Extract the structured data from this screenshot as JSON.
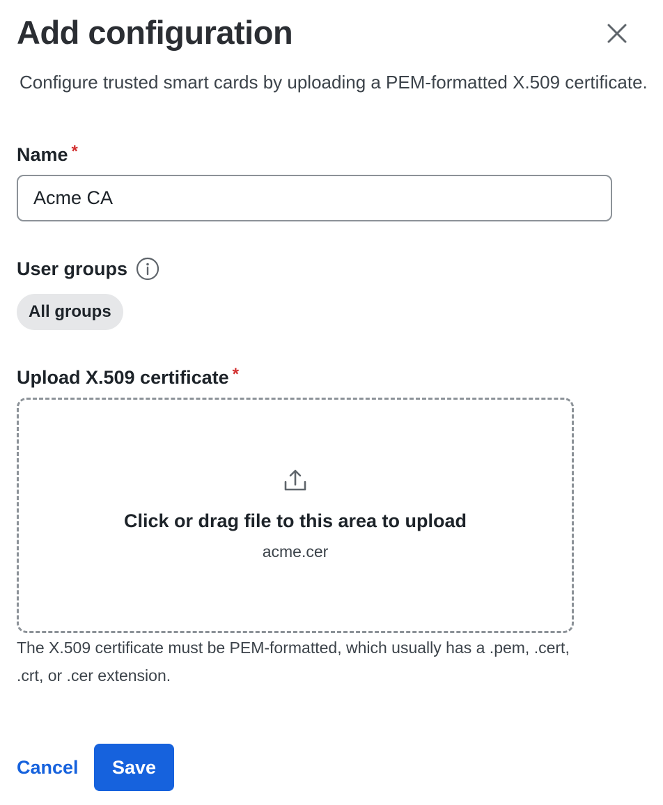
{
  "dialog": {
    "title": "Add configuration",
    "description": "Configure trusted smart cards by uploading a PEM-formatted X.509 certificate."
  },
  "name_field": {
    "label": "Name",
    "required_marker": "*",
    "value": "Acme CA"
  },
  "user_groups": {
    "label": "User groups",
    "chip_label": "All groups"
  },
  "upload": {
    "label": "Upload X.509 certificate",
    "required_marker": "*",
    "prompt": "Click or drag file to this area to upload",
    "file_name": "acme.cer",
    "hint": "The X.509 certificate must be PEM-formatted, which usually has a .pem, .cert, .crt, or .cer extension."
  },
  "actions": {
    "cancel_label": "Cancel",
    "save_label": "Save"
  },
  "colors": {
    "primary": "#1662dd",
    "required": "#d22f2f",
    "border": "#8c9298",
    "chip_bg": "#e6e7e9"
  },
  "icons": {
    "close": "close-icon",
    "info": "info-icon",
    "upload": "upload-icon"
  }
}
